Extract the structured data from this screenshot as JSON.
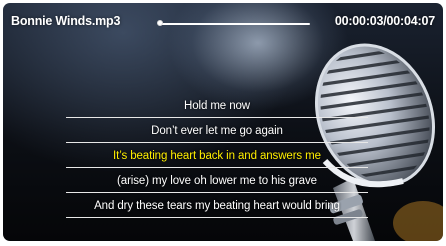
{
  "player": {
    "track_title": "Bonnie Winds.mp3",
    "time_display": "00:00:03/00:04:07",
    "progress_fraction": 0.012,
    "colors": {
      "lyric": "#ffffff",
      "active_lyric": "#ffef00"
    }
  },
  "lyrics": {
    "lines": [
      {
        "text": "Hold me now",
        "active": false
      },
      {
        "text": "Don’t ever let me go again",
        "active": false
      },
      {
        "text": "It’s beating heart back in and answers me",
        "active": true
      },
      {
        "text": "(arise) my love oh lower me to his grave",
        "active": false
      },
      {
        "text": "And dry these tears my beating heart would bring",
        "active": false
      }
    ]
  },
  "icons": [
    "microphone-icon"
  ]
}
